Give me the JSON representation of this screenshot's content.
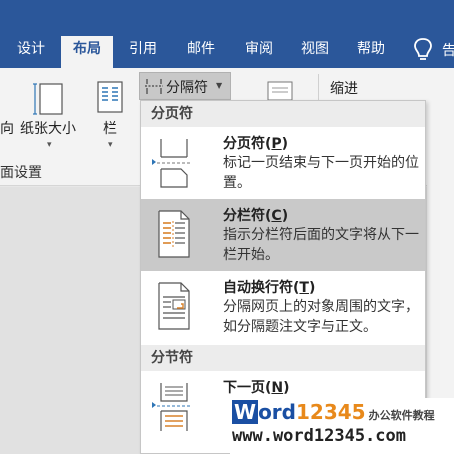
{
  "tabs": [
    {
      "label": "设计",
      "active": false
    },
    {
      "label": "布局",
      "active": true
    },
    {
      "label": "引用",
      "active": false
    },
    {
      "label": "邮件",
      "active": false
    },
    {
      "label": "审阅",
      "active": false
    },
    {
      "label": "视图",
      "active": false
    },
    {
      "label": "帮助",
      "active": false
    }
  ],
  "tell_me_partial": "告",
  "ribbon": {
    "orientation_partial": "向",
    "paper_size": "纸张大小",
    "columns": "栏",
    "breaks": "分隔符",
    "indent": "缩进",
    "group_name": "面设置"
  },
  "menu": {
    "page_breaks_header": "分页符",
    "section_breaks_header": "分节符",
    "items": [
      {
        "title": "分页符",
        "key": "P",
        "desc": "标记一页结束与下一页开始的位置。",
        "hover": false,
        "icon": "page-break-icon"
      },
      {
        "title": "分栏符",
        "key": "C",
        "desc": "指示分栏符后面的文字将从下一栏开始。",
        "hover": true,
        "icon": "column-break-icon"
      },
      {
        "title": "自动换行符",
        "key": "T",
        "desc": "分隔网页上的对象周围的文字，如分隔题注文字与正文。",
        "hover": false,
        "icon": "text-wrapping-break-icon"
      },
      {
        "title": "下一页",
        "key": "N",
        "desc": "",
        "hover": false,
        "icon": "next-page-section-icon"
      }
    ]
  },
  "watermark": {
    "brand_w": "W",
    "brand_ord": "ord",
    "brand_num": "12345",
    "brand_sub": "办公软件教程",
    "url": "www.word12345.com"
  },
  "colors": {
    "tab_bar": "#2b579a",
    "ribbon": "#f3f3f3",
    "menu_hover": "#c9c9c9",
    "icon_accent": "#d9822b",
    "arrow_blue": "#2e75b6"
  }
}
